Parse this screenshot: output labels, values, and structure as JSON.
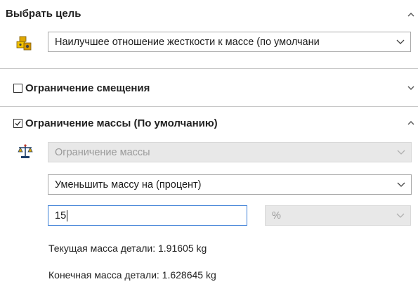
{
  "goal_section": {
    "title": "Выбрать цель",
    "goal_select": {
      "value": "Наилучшее отношение жесткости к массе (по умолчани"
    },
    "icon": "target-goal-icon"
  },
  "displacement_section": {
    "checkbox_checked": false,
    "label": "Ограничение смещения"
  },
  "mass_section": {
    "checkbox_checked": true,
    "label": "Ограничение массы (По умолчанию)",
    "icon": "scales-icon",
    "constraint_select": {
      "value": "Ограничение массы"
    },
    "mode_select": {
      "value": "Уменьшить массу на (процент)"
    },
    "amount_input": {
      "value": "15"
    },
    "unit_select": {
      "value": "%"
    },
    "current_mass": "Текущая масса детали: 1.91605 kg",
    "final_mass": "Конечная масса детали: 1.628645 kg"
  },
  "colors": {
    "accent": "#3c7fd6",
    "divider": "#c8c8c8",
    "disabled_bg": "#e8e8e8",
    "disabled_text": "#9a9a9a"
  }
}
